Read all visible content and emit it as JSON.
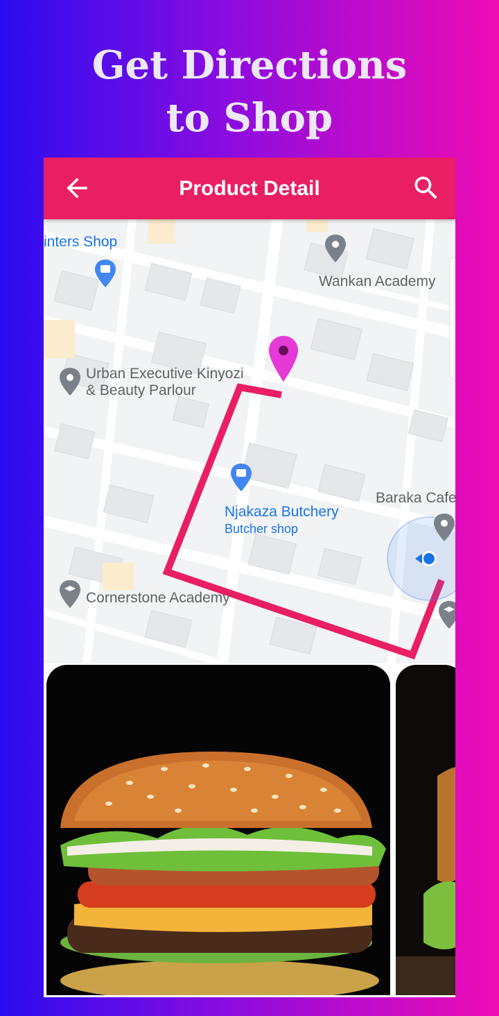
{
  "promo": {
    "headline_line1": "Get Directions",
    "headline_line2": "to Shop"
  },
  "app_bar": {
    "title": "Product Detail",
    "back_icon": "arrow-back-icon",
    "search_icon": "search-icon",
    "background_color": "#e91e63"
  },
  "map": {
    "places": [
      {
        "name": "inters Shop",
        "kind": "shop"
      },
      {
        "name": "Wankan Academy",
        "kind": "place"
      },
      {
        "name": "Urban Executive Kinyozi",
        "name_line2": "& Beauty Parlour",
        "kind": "place"
      },
      {
        "name": "Njakaza Butchery",
        "category": "Butcher shop",
        "kind": "shop"
      },
      {
        "name": "Baraka Cafe",
        "kind": "place"
      },
      {
        "name": "Cornerstone Academy",
        "kind": "school"
      }
    ],
    "route_color": "#e91e63",
    "destination_pin_color": "#e53ad6",
    "current_location_color": "#1a73e8"
  },
  "products": [
    {
      "image": "burger-photo"
    },
    {
      "image": "burger-photo"
    }
  ],
  "colors": {
    "gradient_start": "#2a0cf0",
    "gradient_end": "#f00cb4"
  }
}
